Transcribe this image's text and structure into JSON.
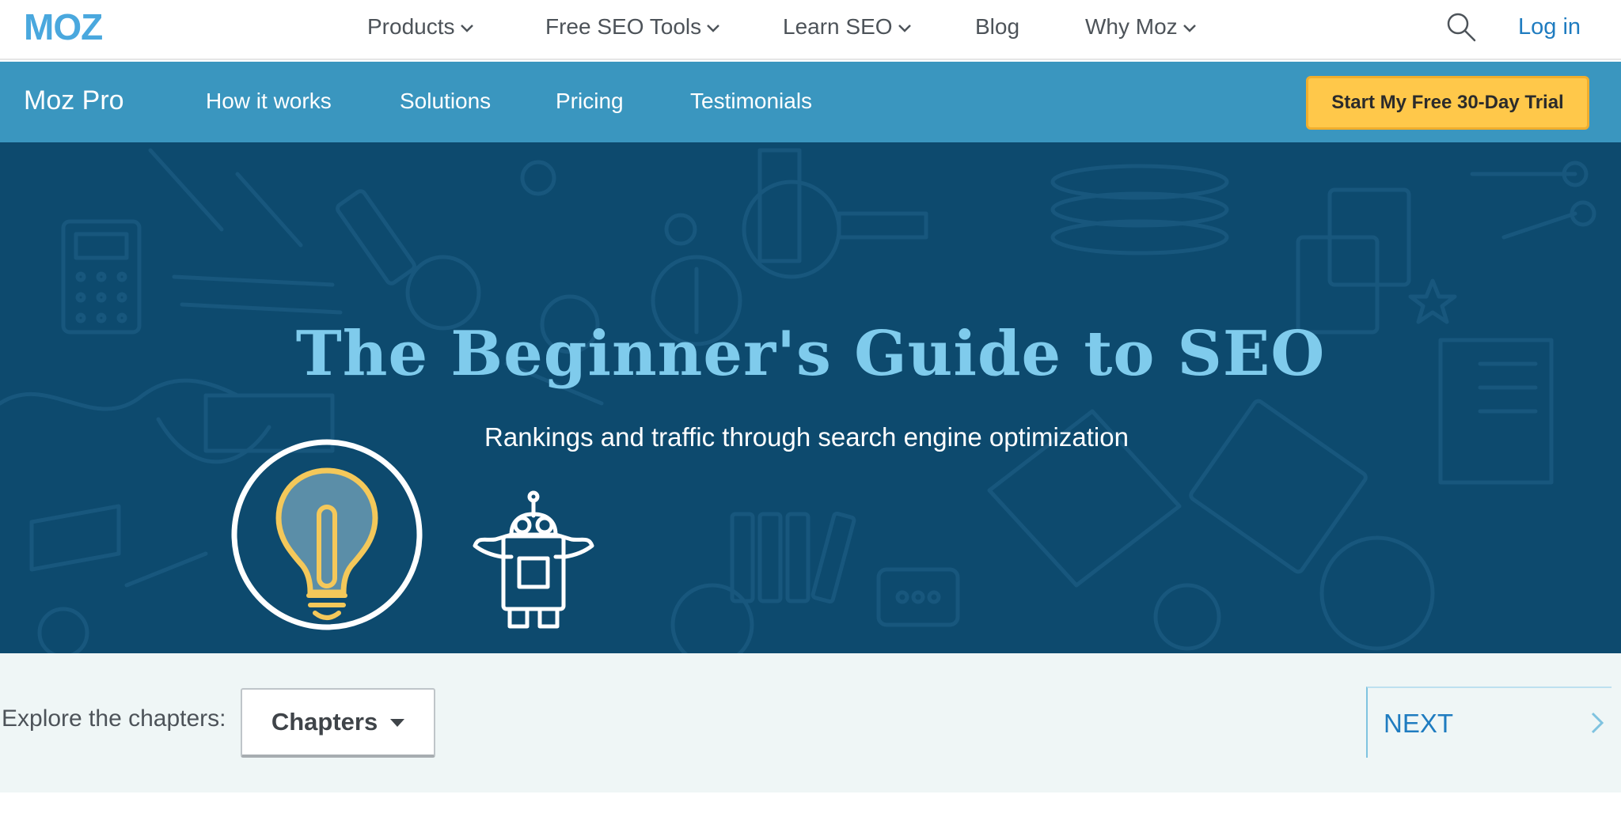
{
  "brand": {
    "logo_text": "MOZ",
    "logo_color": "#4aa8de"
  },
  "topnav": {
    "items": [
      {
        "label": "Products",
        "has_dropdown": true
      },
      {
        "label": "Free SEO Tools",
        "has_dropdown": true
      },
      {
        "label": "Learn SEO",
        "has_dropdown": true
      },
      {
        "label": "Blog",
        "has_dropdown": false
      },
      {
        "label": "Why Moz",
        "has_dropdown": true
      }
    ],
    "search_icon": "search-icon",
    "login_label": "Log in"
  },
  "subnav": {
    "brand": "Moz Pro",
    "links": [
      "How it works",
      "Solutions",
      "Pricing",
      "Testimonials"
    ],
    "cta_label": "Start My Free 30-Day Trial",
    "background_color": "#3a96bf",
    "cta_color": "#ffc84a"
  },
  "hero": {
    "title": "The Beginner's Guide to SEO",
    "subtitle": "Rankings and traffic through search engine optimization",
    "background_color": "#0d4a6e",
    "title_color": "#7fcbec",
    "icons": [
      "lightbulb-icon",
      "robot-icon"
    ]
  },
  "chapters": {
    "explore_label": "Explore the chapters:",
    "dropdown_label": "Chapters",
    "next_label": "NEXT"
  }
}
